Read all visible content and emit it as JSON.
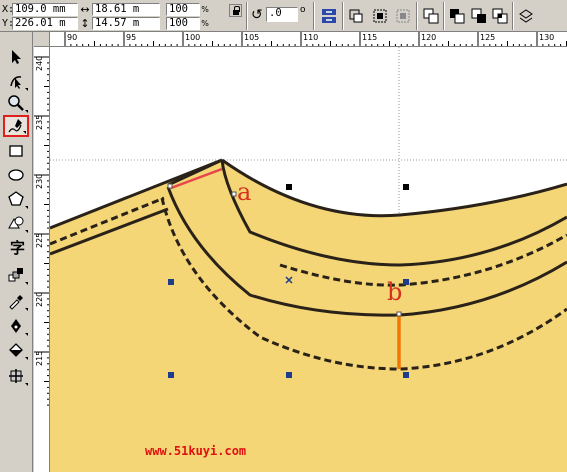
{
  "property_bar": {
    "x_label": "X:",
    "y_label": "Y:",
    "x_value": "109.0 mm",
    "y_value": "226.01 m",
    "width_value": "18.61 m",
    "height_value": "14.57 m",
    "scale_x": "100",
    "scale_y": "100",
    "percent_sign": "%",
    "rotation_value": ".0",
    "degree_sign": "o"
  },
  "rulers": {
    "horizontal_ticks": [
      "90",
      "95",
      "100",
      "105",
      "110",
      "115",
      "120",
      "125",
      "130"
    ],
    "vertical_ticks": [
      "240",
      "235",
      "230",
      "225",
      "220",
      "215"
    ]
  },
  "canvas": {
    "label_a": "a",
    "label_b": "b",
    "watermark": "www.51kuyi.com",
    "fill_color": "#f4d677",
    "outline_color": "#2a2218",
    "measure_color_a": "#e8444c",
    "measure_color_b": "#f07800"
  },
  "tools": [
    {
      "name": "pick-tool",
      "icon": "arrow-icon"
    },
    {
      "name": "shape-tool",
      "icon": "shape-edit-icon"
    },
    {
      "name": "zoom-tool",
      "icon": "magnifier-icon"
    },
    {
      "name": "freehand-tool",
      "icon": "freehand-icon",
      "active": true
    },
    {
      "name": "rectangle-tool",
      "icon": "rectangle-icon"
    },
    {
      "name": "ellipse-tool",
      "icon": "ellipse-icon"
    },
    {
      "name": "polygon-tool",
      "icon": "polygon-icon"
    },
    {
      "name": "basic-shapes-tool",
      "icon": "basic-shapes-icon"
    },
    {
      "name": "text-tool",
      "icon": "text-icon"
    },
    {
      "name": "interactive-blend-tool",
      "icon": "blend-icon"
    },
    {
      "name": "eyedropper-tool",
      "icon": "eyedropper-icon"
    },
    {
      "name": "outline-tool",
      "icon": "pen-nib-icon"
    },
    {
      "name": "fill-tool",
      "icon": "paint-bucket-icon"
    },
    {
      "name": "interactive-fill-tool",
      "icon": "interactive-fill-icon"
    }
  ]
}
